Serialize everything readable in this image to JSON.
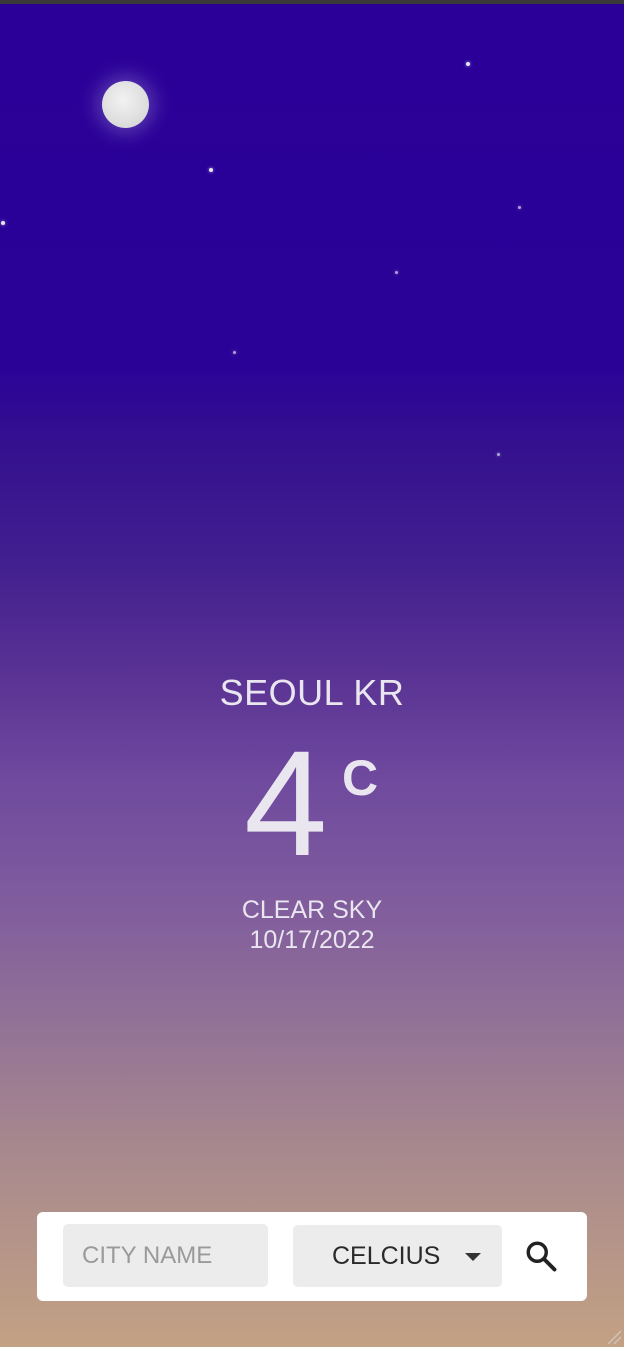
{
  "location": {
    "city": "SEOUL KR"
  },
  "temperature": {
    "value": "4",
    "unit_symbol": "C"
  },
  "conditions": {
    "description": "CLEAR SKY",
    "date": "10/17/2022"
  },
  "controls": {
    "city_input_placeholder": "CITY NAME",
    "city_input_value": "",
    "unit_selected": "CELCIUS",
    "search_icon": "search-icon"
  },
  "theme": {
    "sky_top": "#2b0099",
    "sky_bottom": "#c3a184",
    "text_color": "#e9e6ef"
  }
}
